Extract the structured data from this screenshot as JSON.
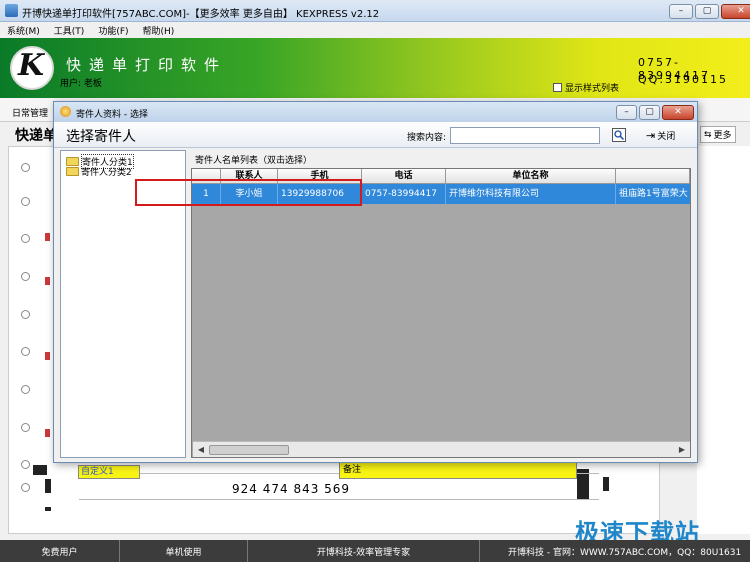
{
  "window": {
    "title": "开博快递单打印软件[757ABC.COM]-【更多效率 更多自由】  KEXPRESS v2.12",
    "min_icon": "minimize-icon",
    "max_icon": "maximize-icon",
    "close_icon": "close-icon"
  },
  "menu": [
    "系统(M)",
    "工具(T)",
    "功能(F)",
    "帮助(H)"
  ],
  "banner": {
    "logo_letter": "K",
    "app_name": "快递单打印软件",
    "user": "用户: 老板",
    "phone": "0757-83994417",
    "qq": "QQ:3190115",
    "show_style": "显示样式列表"
  },
  "main": {
    "daily_tab": "日常管理",
    "express_title": "快递单",
    "more_label": "更多"
  },
  "sheet": {
    "custom_field": "自定义1",
    "remark_field": "备注",
    "barcode_digits": "924 474 843 569"
  },
  "dialog": {
    "title": "寄件人资料 - 选择",
    "heading": "选择寄件人",
    "search_label": "搜索内容:",
    "search_value": "",
    "close_label": "关闭",
    "tree": [
      "寄件人分类1",
      "寄件人分类2"
    ],
    "grid_caption": "寄件人名单列表（双击选择）",
    "columns": [
      "",
      "联系人",
      "手机",
      "电话",
      "单位名称",
      ""
    ],
    "rows": [
      [
        "1",
        "李小姐",
        "13929988706",
        "0757-83994417",
        "开博维尔科技有限公司",
        "祖庙路1号富荣大"
      ]
    ]
  },
  "status": [
    "免费用户",
    "单机使用",
    "开博科技-效率管理专家",
    "开博科技 - 官网：WWW.757ABC.COM，QQ：80U1631"
  ],
  "watermark": "极速下载站",
  "colors": {
    "selection": "#2f88d9",
    "highlight_box": "#d41a1a",
    "field_yellow": "#f9f414"
  }
}
